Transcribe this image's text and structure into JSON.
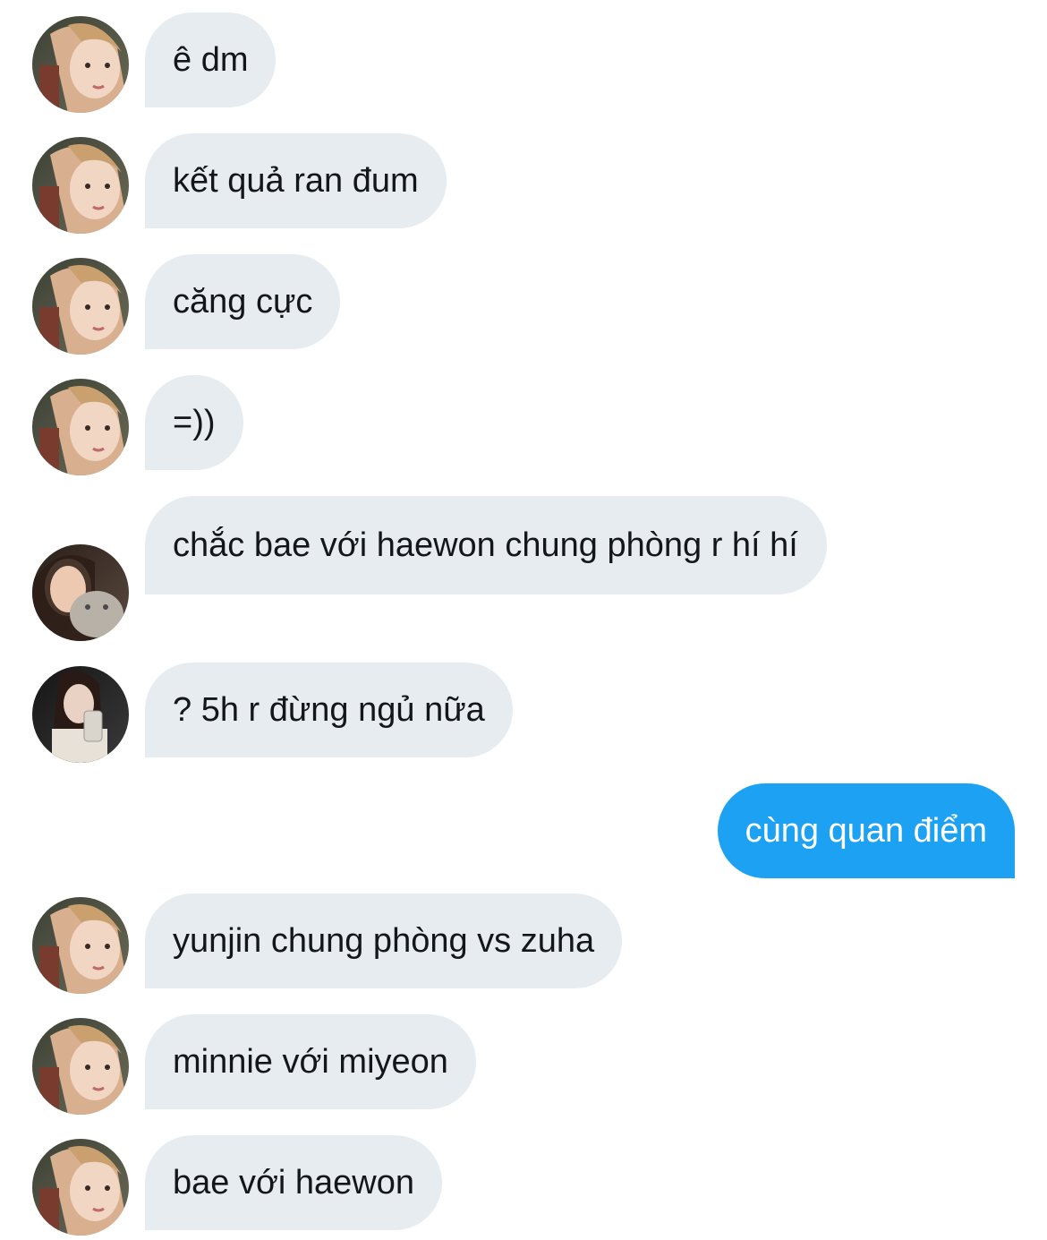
{
  "messages": [
    {
      "side": "in",
      "avatar": "avatar-a",
      "text": "ê dm"
    },
    {
      "side": "in",
      "avatar": "avatar-a",
      "text": "kết quả ran đum"
    },
    {
      "side": "in",
      "avatar": "avatar-a",
      "text": "căng cực"
    },
    {
      "side": "in",
      "avatar": "avatar-a",
      "text": "=))"
    },
    {
      "side": "in",
      "avatar": "avatar-b",
      "text": "chắc bae với haewon chung phòng r hí hí"
    },
    {
      "side": "in",
      "avatar": "avatar-c",
      "text": "? 5h r đừng ngủ nữa"
    },
    {
      "side": "out",
      "text": "cùng quan điểm"
    },
    {
      "side": "in",
      "avatar": "avatar-a",
      "text": "yunjin chung phòng vs zuha"
    },
    {
      "side": "in",
      "avatar": "avatar-a",
      "text": "minnie với miyeon"
    },
    {
      "side": "in",
      "avatar": "avatar-a",
      "text": "bae với haewon"
    }
  ],
  "colors": {
    "incoming_bubble": "#e7ecf0",
    "outgoing_bubble": "#1da1f2",
    "incoming_text": "#14171a",
    "outgoing_text": "#ffffff"
  }
}
